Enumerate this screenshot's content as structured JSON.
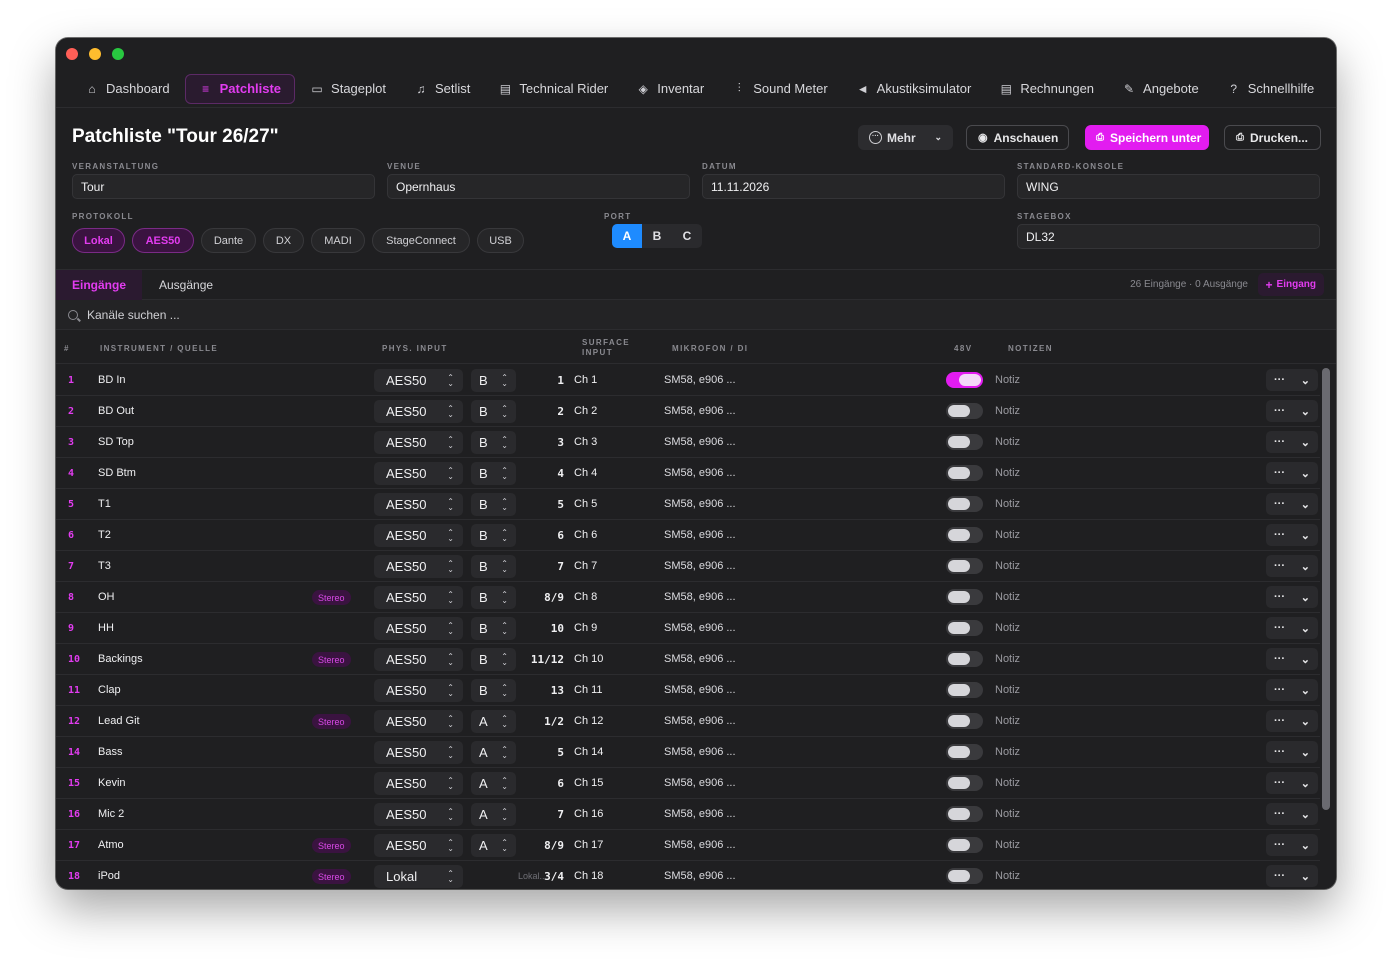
{
  "nav": [
    {
      "icon": "house-icon",
      "glyph": "⌂",
      "label": "Dashboard",
      "active": false
    },
    {
      "icon": "list-icon",
      "glyph": "≡",
      "label": "Patchliste",
      "active": true
    },
    {
      "icon": "layout-icon",
      "glyph": "▭",
      "label": "Stageplot",
      "active": false
    },
    {
      "icon": "music-list-icon",
      "glyph": "♫",
      "label": "Setlist",
      "active": false
    },
    {
      "icon": "document-icon",
      "glyph": "▤",
      "label": "Technical Rider",
      "active": false
    },
    {
      "icon": "box-icon",
      "glyph": "◈",
      "label": "Inventar",
      "active": false
    },
    {
      "icon": "waveform-icon",
      "glyph": "⫶",
      "label": "Sound Meter",
      "active": false
    },
    {
      "icon": "speaker-icon",
      "glyph": "◄",
      "label": "Akustiksimulator",
      "active": false
    },
    {
      "icon": "invoice-icon",
      "glyph": "▤",
      "label": "Rechnungen",
      "active": false
    },
    {
      "icon": "offer-icon",
      "glyph": "✎",
      "label": "Angebote",
      "active": false
    },
    {
      "icon": "help-icon",
      "glyph": "?",
      "label": "Schnellhilfe",
      "active": false
    }
  ],
  "header": {
    "title": "Patchliste \"Tour 26/27\"",
    "mehr_label": "Mehr",
    "anschauen_label": "Anschauen",
    "save_label": "Speichern unter",
    "print_label": "Drucken..."
  },
  "fields": {
    "veranstaltung": {
      "label": "VERANSTALTUNG",
      "value": "Tour"
    },
    "venue": {
      "label": "VENUE",
      "value": "Opernhaus"
    },
    "datum": {
      "label": "DATUM",
      "value": "11.11.2026"
    },
    "konsole": {
      "label": "STANDARD-KONSOLE",
      "value": "WING"
    },
    "protokoll": {
      "label": "PROTOKOLL"
    },
    "port": {
      "label": "PORT"
    },
    "stagebox": {
      "label": "STAGEBOX",
      "value": "DL32"
    }
  },
  "protocols": [
    {
      "label": "Lokal",
      "active": true
    },
    {
      "label": "AES50",
      "active": true
    },
    {
      "label": "Dante",
      "active": false
    },
    {
      "label": "DX",
      "active": false
    },
    {
      "label": "MADI",
      "active": false
    },
    {
      "label": "StageConnect",
      "active": false
    },
    {
      "label": "USB",
      "active": false
    }
  ],
  "ports": [
    {
      "label": "A",
      "active": true
    },
    {
      "label": "B",
      "active": false
    },
    {
      "label": "C",
      "active": false
    }
  ],
  "tabs": {
    "inputs": "Eingänge",
    "outputs": "Ausgänge",
    "counts": "26 Eingänge · 0 Ausgänge",
    "add": "Eingang"
  },
  "search": {
    "placeholder": "Kanäle suchen ..."
  },
  "columns": {
    "num": "#",
    "instrument": "INSTRUMENT / QUELLE",
    "phys": "PHYS. INPUT",
    "surface1": "SURFACE",
    "surface2": "INPUT",
    "mic": "MIKROFON / DI",
    "v48": "48V",
    "notes": "NOTIZEN"
  },
  "stereo_label": "Stereo",
  "rows": [
    {
      "num": "1",
      "name": "BD In",
      "stereo": false,
      "phys": "AES50",
      "port": "B",
      "input": "1",
      "ch": "Ch 1",
      "mic": "SM58, e906 ...",
      "p48": true,
      "note": "Notiz"
    },
    {
      "num": "2",
      "name": "BD Out",
      "stereo": false,
      "phys": "AES50",
      "port": "B",
      "input": "2",
      "ch": "Ch 2",
      "mic": "SM58, e906 ...",
      "p48": false,
      "note": "Notiz"
    },
    {
      "num": "3",
      "name": "SD Top",
      "stereo": false,
      "phys": "AES50",
      "port": "B",
      "input": "3",
      "ch": "Ch 3",
      "mic": "SM58, e906 ...",
      "p48": false,
      "note": "Notiz"
    },
    {
      "num": "4",
      "name": "SD Btm",
      "stereo": false,
      "phys": "AES50",
      "port": "B",
      "input": "4",
      "ch": "Ch 4",
      "mic": "SM58, e906 ...",
      "p48": false,
      "note": "Notiz"
    },
    {
      "num": "5",
      "name": "T1",
      "stereo": false,
      "phys": "AES50",
      "port": "B",
      "input": "5",
      "ch": "Ch 5",
      "mic": "SM58, e906 ...",
      "p48": false,
      "note": "Notiz"
    },
    {
      "num": "6",
      "name": "T2",
      "stereo": false,
      "phys": "AES50",
      "port": "B",
      "input": "6",
      "ch": "Ch 6",
      "mic": "SM58, e906 ...",
      "p48": false,
      "note": "Notiz"
    },
    {
      "num": "7",
      "name": "T3",
      "stereo": false,
      "phys": "AES50",
      "port": "B",
      "input": "7",
      "ch": "Ch 7",
      "mic": "SM58, e906 ...",
      "p48": false,
      "note": "Notiz"
    },
    {
      "num": "8",
      "name": "OH",
      "stereo": true,
      "phys": "AES50",
      "port": "B",
      "input": "8/9",
      "ch": "Ch 8",
      "mic": "SM58, e906 ...",
      "p48": false,
      "note": "Notiz"
    },
    {
      "num": "9",
      "name": "HH",
      "stereo": false,
      "phys": "AES50",
      "port": "B",
      "input": "10",
      "ch": "Ch 9",
      "mic": "SM58, e906 ...",
      "p48": false,
      "note": "Notiz"
    },
    {
      "num": "10",
      "name": "Backings",
      "stereo": true,
      "phys": "AES50",
      "port": "B",
      "input": "11/12",
      "ch": "Ch 10",
      "mic": "SM58, e906 ...",
      "p48": false,
      "note": "Notiz"
    },
    {
      "num": "11",
      "name": "Clap",
      "stereo": false,
      "phys": "AES50",
      "port": "B",
      "input": "13",
      "ch": "Ch 11",
      "mic": "SM58, e906 ...",
      "p48": false,
      "note": "Notiz"
    },
    {
      "num": "12",
      "name": "Lead Git",
      "stereo": true,
      "phys": "AES50",
      "port": "A",
      "input": "1/2",
      "ch": "Ch 12",
      "mic": "SM58, e906 ...",
      "p48": false,
      "note": "Notiz"
    },
    {
      "num": "14",
      "name": "Bass",
      "stereo": false,
      "phys": "AES50",
      "port": "A",
      "input": "5",
      "ch": "Ch 14",
      "mic": "SM58, e906 ...",
      "p48": false,
      "note": "Notiz"
    },
    {
      "num": "15",
      "name": "Kevin",
      "stereo": false,
      "phys": "AES50",
      "port": "A",
      "input": "6",
      "ch": "Ch 15",
      "mic": "SM58, e906 ...",
      "p48": false,
      "note": "Notiz"
    },
    {
      "num": "16",
      "name": "Mic 2",
      "stereo": false,
      "phys": "AES50",
      "port": "A",
      "input": "7",
      "ch": "Ch 16",
      "mic": "SM58, e906 ...",
      "p48": false,
      "note": "Notiz"
    },
    {
      "num": "17",
      "name": "Atmo",
      "stereo": true,
      "phys": "AES50",
      "port": "A",
      "input": "8/9",
      "ch": "Ch 17",
      "mic": "SM58, e906 ...",
      "p48": false,
      "note": "Notiz"
    },
    {
      "num": "18",
      "name": "iPod",
      "stereo": true,
      "phys": "Lokal",
      "port": "",
      "input": "3/4",
      "extra": "Lokal...",
      "ch": "Ch 18",
      "mic": "SM58, e906 ...",
      "p48": false,
      "note": "Notiz"
    }
  ]
}
